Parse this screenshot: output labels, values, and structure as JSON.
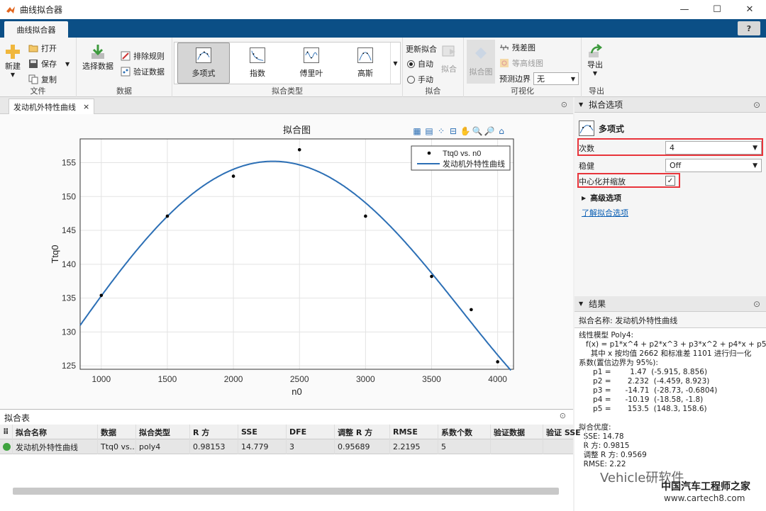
{
  "window": {
    "title": "曲线拟合器",
    "minimize": "—",
    "maximize": "☐",
    "close": "✕"
  },
  "tabs": {
    "main": "曲线拟合器",
    "help": "?"
  },
  "ribbon": {
    "file": {
      "label": "文件",
      "new": "新建",
      "open": "打开",
      "save": "保存",
      "copy": "复制"
    },
    "data": {
      "label": "数据",
      "select": "选择数据",
      "exclusion": "排除规则",
      "validation": "验证数据"
    },
    "fit_type": {
      "label": "拟合类型",
      "items": [
        "多项式",
        "指数",
        "傅里叶",
        "高斯"
      ]
    },
    "fit": {
      "label": "拟合",
      "auto_update": "更新拟合",
      "auto": "自动",
      "manual": "手动",
      "fit_button": "拟合"
    },
    "visual": {
      "label": "可视化",
      "fit_plot": "拟合图",
      "residuals": "残差图",
      "contour": "等高线图",
      "pred_bounds": "预测边界",
      "pred_value": "无"
    },
    "export": {
      "label": "导出",
      "export": "导出"
    }
  },
  "doc": {
    "tab": "发动机外特性曲线",
    "close": "×"
  },
  "plot_tools": [
    "▦",
    "▤",
    "⁘",
    "⊟",
    "✋",
    "🔍",
    "🔎",
    "⌂"
  ],
  "chart_data": {
    "type": "scatter",
    "title": "拟合图",
    "xlabel": "n0",
    "ylabel": "Ttq0",
    "xlim": [
      840,
      4120
    ],
    "ylim": [
      124.5,
      158.5
    ],
    "xticks": [
      "1000",
      "1500",
      "2000",
      "2500",
      "3000",
      "3500",
      "4000"
    ],
    "yticks": [
      "125",
      "130",
      "135",
      "140",
      "145",
      "150",
      "155"
    ],
    "grid": true,
    "legend": {
      "placement": "top-right",
      "entries": [
        "Ttq0 vs. n0",
        "发动机外特性曲线"
      ]
    },
    "points": [
      [
        1000,
        135.4
      ],
      [
        1500,
        147.1
      ],
      [
        2000,
        153.0
      ],
      [
        2500,
        156.9
      ],
      [
        3000,
        147.1
      ],
      [
        3500,
        138.2
      ],
      [
        3800,
        133.3
      ],
      [
        4000,
        125.6
      ]
    ],
    "fit": {
      "p1": 1.47,
      "p2": 2.232,
      "p3": -14.71,
      "p4": -10.19,
      "p5": 153.5,
      "mean": 2662,
      "std": 1101
    },
    "colors": {
      "points": "#000000",
      "curve": "#2c6fb5"
    }
  },
  "options": {
    "header": "拟合选项",
    "model_name": "多项式",
    "degree_label": "次数",
    "degree_value": "4",
    "robust_label": "稳健",
    "robust_value": "Off",
    "center_label": "中心化并缩放",
    "center_check": "✓",
    "advanced": "高级选项",
    "learn_more": "了解拟合选项"
  },
  "results": {
    "header": "结果",
    "fit_name": "拟合名称: 发动机外特性曲线",
    "lines": [
      "线性模型 Poly4:",
      "   f(x) = p1*x^4 + p2*x^3 + p3*x^2 + p4*x + p5",
      "     其中 x 按均值 2662 和标准差 1101 进行归一化",
      "系数(置信边界为 95%):",
      "      p1 =        1.47  (-5.915, 8.856)",
      "      p2 =       2.232  (-4.459, 8.923)",
      "      p3 =      -14.71  (-28.73, -0.6804)",
      "      p4 =      -10.19  (-18.58, -1.8)",
      "      p5 =       153.5  (148.3, 158.6)",
      "",
      "拟合优度:",
      "  SSE: 14.78",
      "  R 方: 0.9815",
      "  调整 R 方: 0.9569",
      "  RMSE: 2.22"
    ]
  },
  "table": {
    "header": "拟合表",
    "columns": [
      "拟合名称",
      "数据",
      "拟合类型",
      "R 方",
      "SSE",
      "DFE",
      "调整 R 方",
      "RMSE",
      "系数个数",
      "验证数据",
      "验证 SSE"
    ],
    "rows": [
      [
        "发动机外特性曲线",
        "Ttq0 vs...",
        "poly4",
        "0.98153",
        "14.779",
        "3",
        "0.95689",
        "2.2195",
        "5",
        "",
        ""
      ]
    ]
  },
  "watermark": {
    "a": "Vehicle研软件",
    "b": "中国汽车工程师之家",
    "c": "www.cartech8.com"
  }
}
